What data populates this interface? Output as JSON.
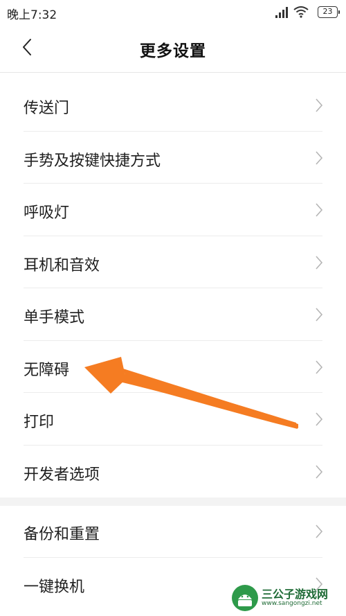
{
  "status_bar": {
    "time": "晚上7:32",
    "battery": "23"
  },
  "header": {
    "title": "更多设置"
  },
  "list_group_1": [
    {
      "label": "传送门"
    },
    {
      "label": "手势及按键快捷方式"
    },
    {
      "label": "呼吸灯"
    },
    {
      "label": "耳机和音效"
    },
    {
      "label": "单手模式"
    },
    {
      "label": "无障碍"
    },
    {
      "label": "打印"
    },
    {
      "label": "开发者选项"
    }
  ],
  "list_group_2": [
    {
      "label": "备份和重置"
    },
    {
      "label": "一键换机"
    }
  ],
  "watermark": {
    "name": "三公子游戏网",
    "url": "www.sangongzi.net"
  },
  "colors": {
    "annotation_arrow": "#f57c22",
    "chevron": "#b5b5b5",
    "watermark_green": "#1f6b36"
  }
}
